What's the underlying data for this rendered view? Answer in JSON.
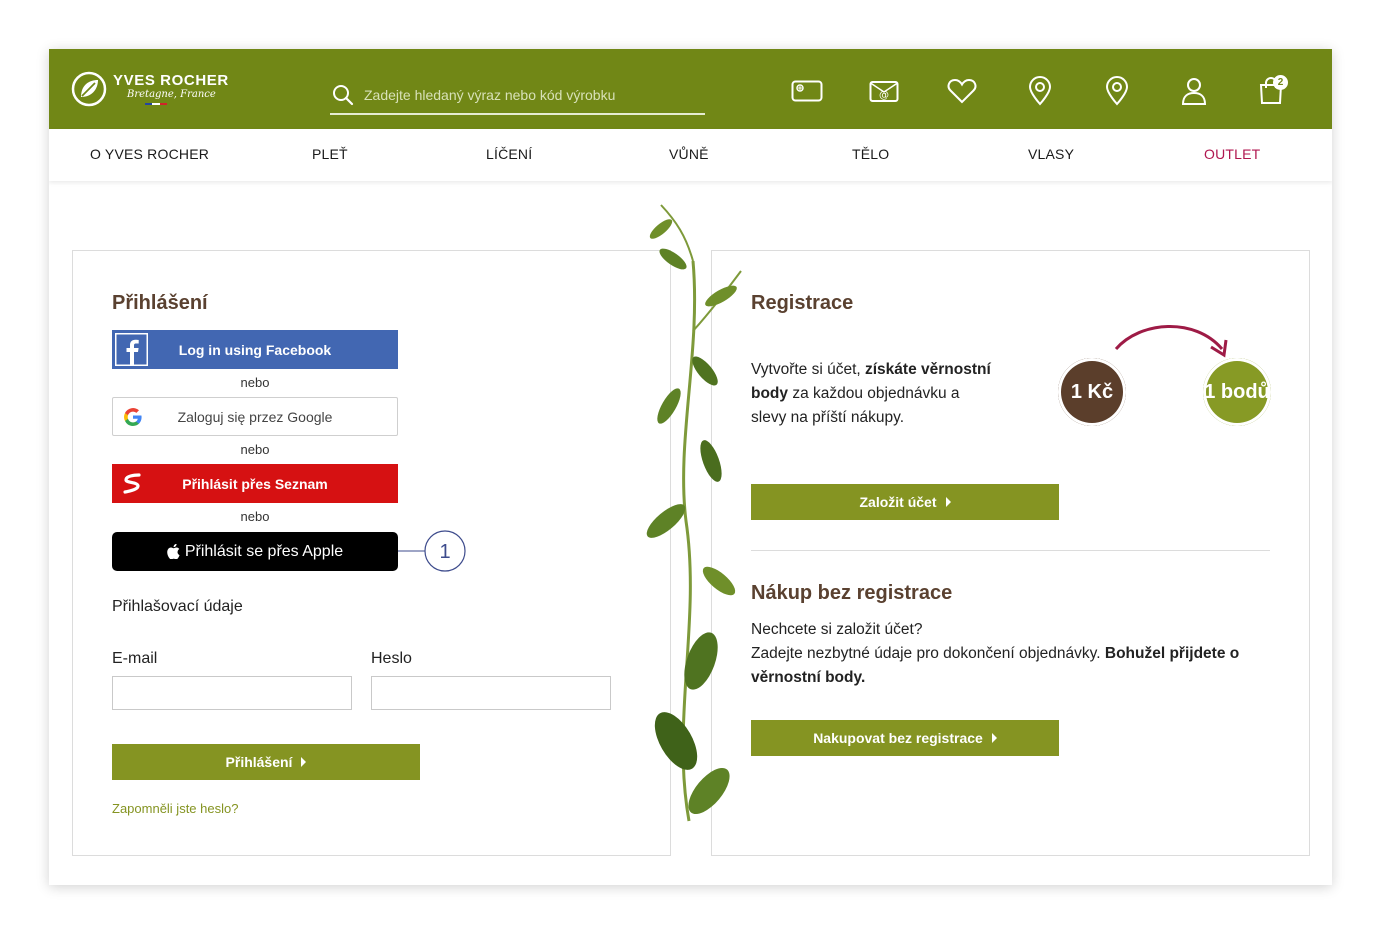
{
  "header": {
    "brand_name": "YVES ROCHER",
    "brand_sub": "Bretagne, France",
    "search_placeholder": "Zadejte hledaný výraz nebo kód výrobku",
    "cart_count": "2",
    "icons": [
      "gift-card-icon",
      "email-icon",
      "heart-icon",
      "location-pin-icon",
      "location-pin-icon",
      "user-icon",
      "shopping-bag-icon"
    ],
    "brand_color": "#718716"
  },
  "nav": {
    "items": [
      "O YVES ROCHER",
      "PLEŤ",
      "LÍČENÍ",
      "VŮNĚ",
      "TĚLO",
      "VLASY",
      "OUTLET"
    ]
  },
  "login": {
    "title": "Přihlášení",
    "facebook_label": "Log in using Facebook",
    "or_label": "nebo",
    "google_label": "Zaloguj się przez Google",
    "seznam_label": "Přihlásit přes Seznam",
    "apple_label": "Přihlásit se přes Apple",
    "callout_number": "1",
    "credentials_heading": "Přihlašovací údaje",
    "email_label": "E-mail",
    "password_label": "Heslo",
    "submit_label": "Přihlášení",
    "forgot_label": "Zapomněli jste heslo?"
  },
  "register": {
    "title": "Registrace",
    "text_1": "Vytvořte si účet, ",
    "text_bold": "získáte věrnostní body",
    "text_2": " za každou objednávku a slevy na příští nákupy.",
    "coin_left": "1 Kč",
    "coin_right": "1 bodů",
    "button_label": "Založit účet"
  },
  "guest": {
    "title": "Nákup bez registrace",
    "line_1": "Nechcete si založit účet?",
    "line_2": "Zadejte nezbytné údaje pro dokončení objednávky. ",
    "line_2_bold": "Bohužel přijdete o věrnostní body.",
    "button_label": "Nakupovat bez registrace"
  },
  "colors": {
    "green": "#718716",
    "button_green": "#859422",
    "facebook": "#4267b2",
    "seznam": "#d61112",
    "outlet": "#b0164f",
    "heading_brown": "#5a4130"
  }
}
